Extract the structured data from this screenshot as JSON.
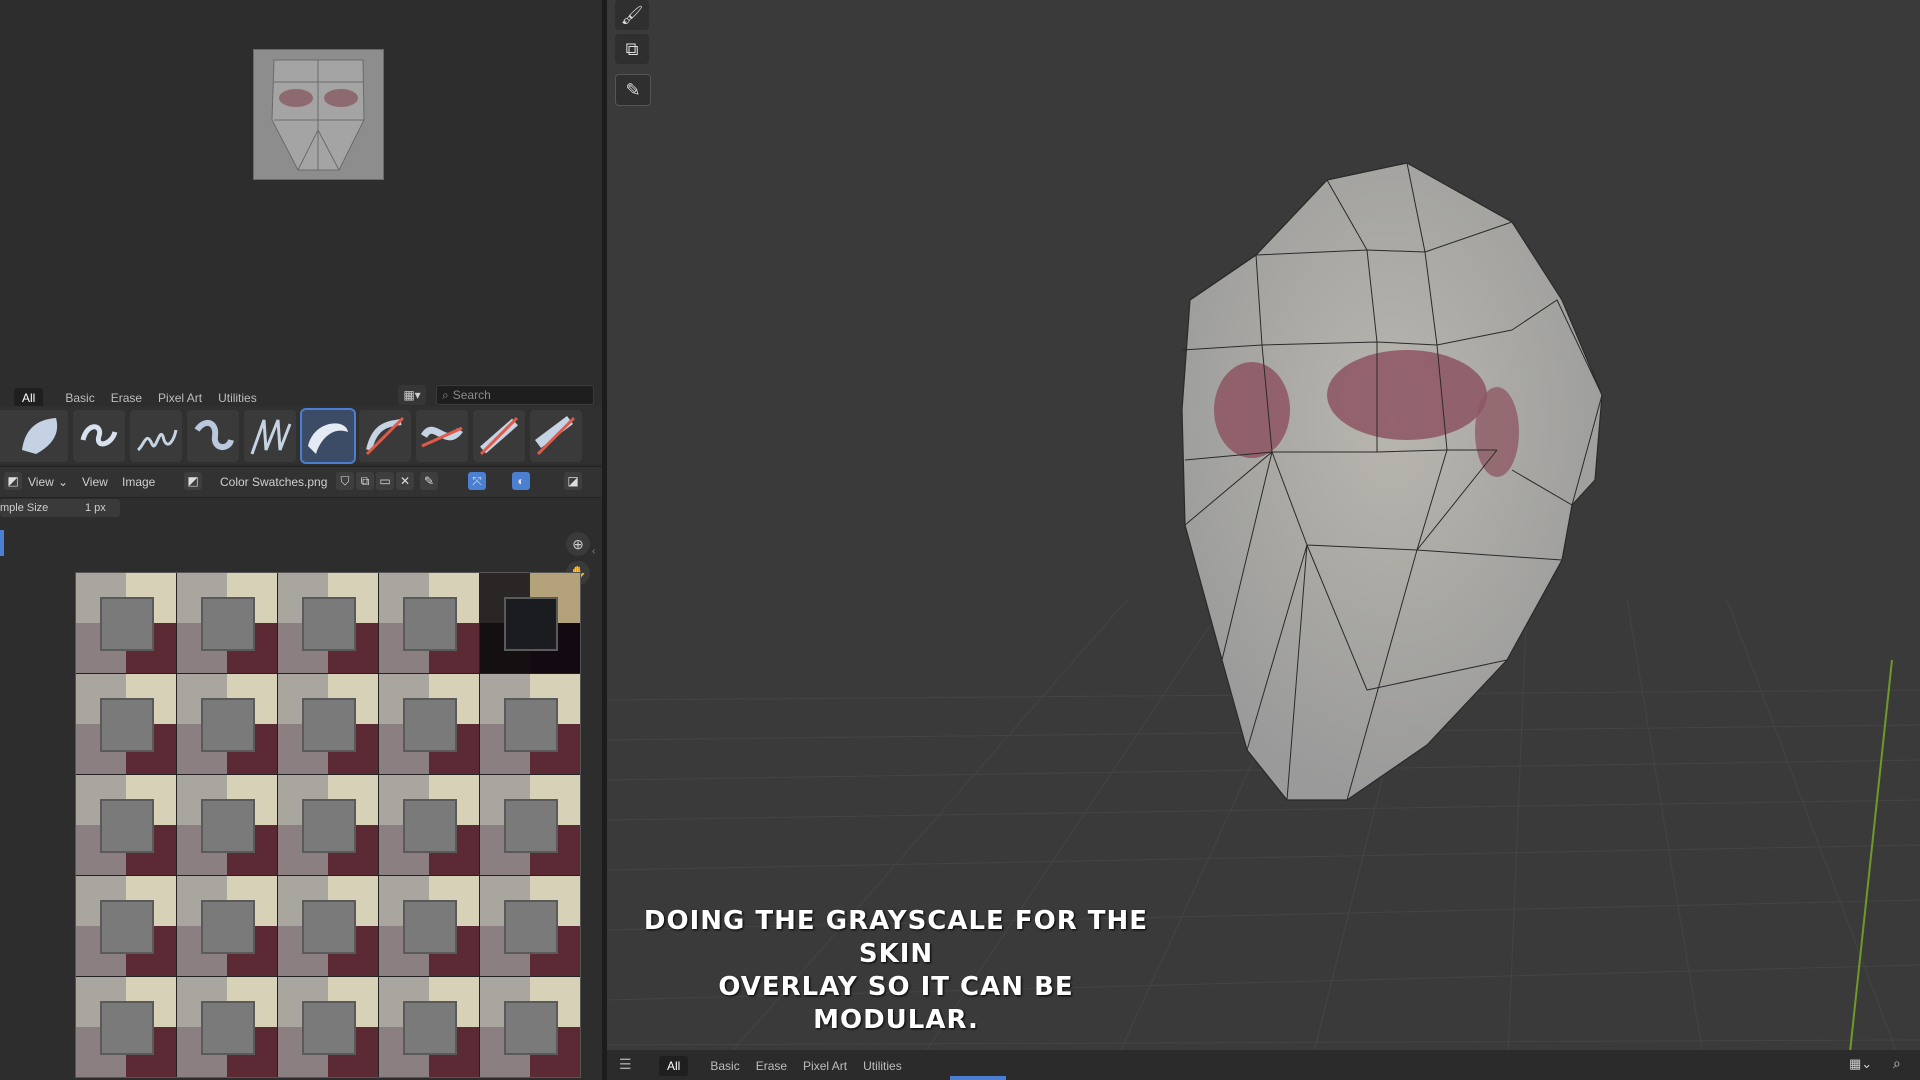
{
  "asset_shelf_top": {
    "tabs": [
      "All",
      "Basic",
      "Erase",
      "Pixel Art",
      "Utilities"
    ],
    "active_tab": "All",
    "search_placeholder": "Search"
  },
  "image_editor": {
    "menus": [
      "View",
      "View",
      "Image"
    ],
    "image_name": "Color Swatches.png",
    "sample_size_label": "mple Size",
    "sample_size_value": "1 px"
  },
  "viewport": {
    "caption_line1": "Doing the grayscale for the skin",
    "caption_line2": "overlay so it can be modular."
  },
  "asset_shelf_bottom": {
    "tabs": [
      "All",
      "Basic",
      "Erase",
      "Pixel Art",
      "Utilities"
    ],
    "active_tab": "All"
  },
  "icons": [
    "brush-icon",
    "clone-icon",
    "annotate-icon",
    "zoom-icon",
    "hand-icon",
    "search-icon",
    "menu-icon",
    "grid-icon",
    "pin-icon",
    "close-icon"
  ],
  "colors": {
    "accent": "#4b7fd1",
    "viewport_bg": "#3a3a3a",
    "panel_bg": "#2d2d2d"
  }
}
